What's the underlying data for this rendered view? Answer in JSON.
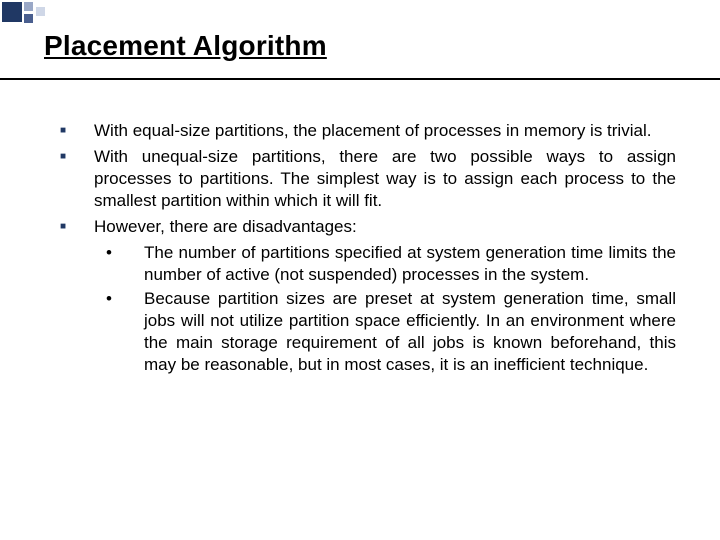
{
  "title": "Placement Algorithm",
  "bullets": [
    {
      "text": "With equal-size partitions, the placement of processes in memory is trivial."
    },
    {
      "text": "With unequal-size partitions, there are two possible ways to assign processes to partitions. The simplest way is to assign each process to the smallest partition within which it will fit."
    },
    {
      "text": "However, there are disadvantages:"
    }
  ],
  "sub_bullets": [
    {
      "marker": "•",
      "text": "The number of partitions specified at system generation time limits the number of active (not suspended) processes in the system."
    },
    {
      "marker": "•",
      "text": "Because partition sizes are preset at system generation time, small jobs will not utilize partition space efficiently. In an environment where the main storage requirement of all jobs is known beforehand, this may be reasonable, but in most cases, it is an inefficient technique."
    }
  ]
}
